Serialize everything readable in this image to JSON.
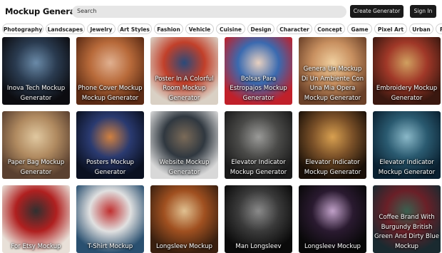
{
  "header": {
    "brand": "Mockup Generator",
    "search_placeholder": "Search",
    "create_label": "Create Generator",
    "signin_label": "Sign In"
  },
  "categories": [
    "Photography",
    "Landscapes",
    "Jewelry",
    "Art Styles",
    "Fashion",
    "Vehicle",
    "Cuisine",
    "Design",
    "Character",
    "Concept",
    "Game",
    "Pixel Art",
    "Urban",
    "F"
  ],
  "cards": [
    {
      "caption": "Inova Tech Mockup Generator",
      "colors": [
        "#0c0c10",
        "#2a3b50",
        "#6a8aa8"
      ]
    },
    {
      "caption": "Phone Cover Mockup Mockup Generator",
      "colors": [
        "#5a2a14",
        "#b86a3a",
        "#e0b090"
      ]
    },
    {
      "caption": "Poster In A Colorful Room Mockup Generator",
      "colors": [
        "#d9d0c4",
        "#c2402a",
        "#2a4a7a"
      ]
    },
    {
      "caption": "Bolsas Para Estropajos Mockup Generator",
      "colors": [
        "#c0202a",
        "#3a6ab0",
        "#e8d0c0"
      ]
    },
    {
      "caption": "Genera Un Mockup Di Un Ambiente Con Una Mia Opera Mockup Generator",
      "colors": [
        "#6a4028",
        "#c89060",
        "#f0d0a0"
      ]
    },
    {
      "caption": "Embroidery Mockup Generator",
      "colors": [
        "#3a1810",
        "#a03828",
        "#d0a060"
      ]
    },
    {
      "caption": "Paper Bag Mockup Generator",
      "colors": [
        "#5a4030",
        "#b08a60",
        "#e0c8a0"
      ]
    },
    {
      "caption": "Posters Mockup Generator",
      "colors": [
        "#0a1020",
        "#2a3a70",
        "#d08040"
      ]
    },
    {
      "caption": "Website Mockup Generator",
      "colors": [
        "#d8d8d8",
        "#303840",
        "#7a6a58"
      ]
    },
    {
      "caption": "Elevator Indicator Mockup Generator",
      "colors": [
        "#1a1a1a",
        "#4a4a48",
        "#9a9a98"
      ]
    },
    {
      "caption": "Elevator Indicator Mockup Generator",
      "colors": [
        "#1a1008",
        "#7a5028",
        "#d8a050"
      ]
    },
    {
      "caption": "Elevator Indicator Mockup Generator",
      "colors": [
        "#0a2030",
        "#2a5a70",
        "#8ab8c8"
      ]
    },
    {
      "caption": "For Etsy Mockup",
      "colors": [
        "#e8e0d8",
        "#b02020",
        "#303030"
      ]
    },
    {
      "caption": "T-Shirt Mockup",
      "colors": [
        "#2a5070",
        "#e0e0e0",
        "#c03030"
      ]
    },
    {
      "caption": "Longsleev Mockup",
      "colors": [
        "#3a2010",
        "#a05020",
        "#e0c090"
      ]
    },
    {
      "caption": "Man Longsleev",
      "colors": [
        "#0a0a0a",
        "#3a3a3a",
        "#8a8a8a"
      ]
    },
    {
      "caption": "Longsleev Mockup",
      "colors": [
        "#080808",
        "#2a1a30",
        "#c0a0c8"
      ]
    },
    {
      "caption": "Coffee Brand With Burgundy British Green And Dirty Blue Mockup",
      "colors": [
        "#1a2a30",
        "#6a2028",
        "#3a6050"
      ]
    }
  ]
}
